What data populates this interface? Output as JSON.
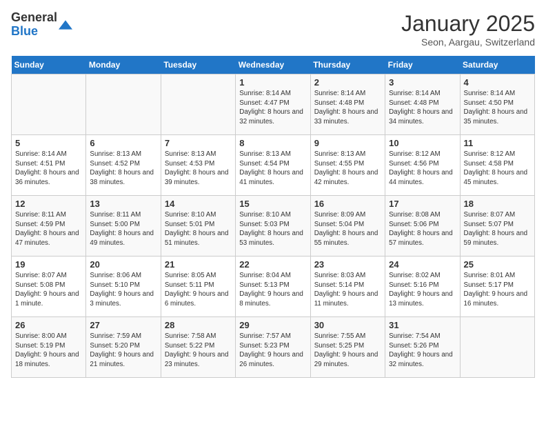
{
  "logo": {
    "general": "General",
    "blue": "Blue"
  },
  "title": "January 2025",
  "subtitle": "Seon, Aargau, Switzerland",
  "days_header": [
    "Sunday",
    "Monday",
    "Tuesday",
    "Wednesday",
    "Thursday",
    "Friday",
    "Saturday"
  ],
  "weeks": [
    [
      {
        "num": "",
        "info": ""
      },
      {
        "num": "",
        "info": ""
      },
      {
        "num": "",
        "info": ""
      },
      {
        "num": "1",
        "info": "Sunrise: 8:14 AM\nSunset: 4:47 PM\nDaylight: 8 hours and 32 minutes."
      },
      {
        "num": "2",
        "info": "Sunrise: 8:14 AM\nSunset: 4:48 PM\nDaylight: 8 hours and 33 minutes."
      },
      {
        "num": "3",
        "info": "Sunrise: 8:14 AM\nSunset: 4:48 PM\nDaylight: 8 hours and 34 minutes."
      },
      {
        "num": "4",
        "info": "Sunrise: 8:14 AM\nSunset: 4:50 PM\nDaylight: 8 hours and 35 minutes."
      }
    ],
    [
      {
        "num": "5",
        "info": "Sunrise: 8:14 AM\nSunset: 4:51 PM\nDaylight: 8 hours and 36 minutes."
      },
      {
        "num": "6",
        "info": "Sunrise: 8:13 AM\nSunset: 4:52 PM\nDaylight: 8 hours and 38 minutes."
      },
      {
        "num": "7",
        "info": "Sunrise: 8:13 AM\nSunset: 4:53 PM\nDaylight: 8 hours and 39 minutes."
      },
      {
        "num": "8",
        "info": "Sunrise: 8:13 AM\nSunset: 4:54 PM\nDaylight: 8 hours and 41 minutes."
      },
      {
        "num": "9",
        "info": "Sunrise: 8:13 AM\nSunset: 4:55 PM\nDaylight: 8 hours and 42 minutes."
      },
      {
        "num": "10",
        "info": "Sunrise: 8:12 AM\nSunset: 4:56 PM\nDaylight: 8 hours and 44 minutes."
      },
      {
        "num": "11",
        "info": "Sunrise: 8:12 AM\nSunset: 4:58 PM\nDaylight: 8 hours and 45 minutes."
      }
    ],
    [
      {
        "num": "12",
        "info": "Sunrise: 8:11 AM\nSunset: 4:59 PM\nDaylight: 8 hours and 47 minutes."
      },
      {
        "num": "13",
        "info": "Sunrise: 8:11 AM\nSunset: 5:00 PM\nDaylight: 8 hours and 49 minutes."
      },
      {
        "num": "14",
        "info": "Sunrise: 8:10 AM\nSunset: 5:01 PM\nDaylight: 8 hours and 51 minutes."
      },
      {
        "num": "15",
        "info": "Sunrise: 8:10 AM\nSunset: 5:03 PM\nDaylight: 8 hours and 53 minutes."
      },
      {
        "num": "16",
        "info": "Sunrise: 8:09 AM\nSunset: 5:04 PM\nDaylight: 8 hours and 55 minutes."
      },
      {
        "num": "17",
        "info": "Sunrise: 8:08 AM\nSunset: 5:06 PM\nDaylight: 8 hours and 57 minutes."
      },
      {
        "num": "18",
        "info": "Sunrise: 8:07 AM\nSunset: 5:07 PM\nDaylight: 8 hours and 59 minutes."
      }
    ],
    [
      {
        "num": "19",
        "info": "Sunrise: 8:07 AM\nSunset: 5:08 PM\nDaylight: 9 hours and 1 minute."
      },
      {
        "num": "20",
        "info": "Sunrise: 8:06 AM\nSunset: 5:10 PM\nDaylight: 9 hours and 3 minutes."
      },
      {
        "num": "21",
        "info": "Sunrise: 8:05 AM\nSunset: 5:11 PM\nDaylight: 9 hours and 6 minutes."
      },
      {
        "num": "22",
        "info": "Sunrise: 8:04 AM\nSunset: 5:13 PM\nDaylight: 9 hours and 8 minutes."
      },
      {
        "num": "23",
        "info": "Sunrise: 8:03 AM\nSunset: 5:14 PM\nDaylight: 9 hours and 11 minutes."
      },
      {
        "num": "24",
        "info": "Sunrise: 8:02 AM\nSunset: 5:16 PM\nDaylight: 9 hours and 13 minutes."
      },
      {
        "num": "25",
        "info": "Sunrise: 8:01 AM\nSunset: 5:17 PM\nDaylight: 9 hours and 16 minutes."
      }
    ],
    [
      {
        "num": "26",
        "info": "Sunrise: 8:00 AM\nSunset: 5:19 PM\nDaylight: 9 hours and 18 minutes."
      },
      {
        "num": "27",
        "info": "Sunrise: 7:59 AM\nSunset: 5:20 PM\nDaylight: 9 hours and 21 minutes."
      },
      {
        "num": "28",
        "info": "Sunrise: 7:58 AM\nSunset: 5:22 PM\nDaylight: 9 hours and 23 minutes."
      },
      {
        "num": "29",
        "info": "Sunrise: 7:57 AM\nSunset: 5:23 PM\nDaylight: 9 hours and 26 minutes."
      },
      {
        "num": "30",
        "info": "Sunrise: 7:55 AM\nSunset: 5:25 PM\nDaylight: 9 hours and 29 minutes."
      },
      {
        "num": "31",
        "info": "Sunrise: 7:54 AM\nSunset: 5:26 PM\nDaylight: 9 hours and 32 minutes."
      },
      {
        "num": "",
        "info": ""
      }
    ]
  ]
}
